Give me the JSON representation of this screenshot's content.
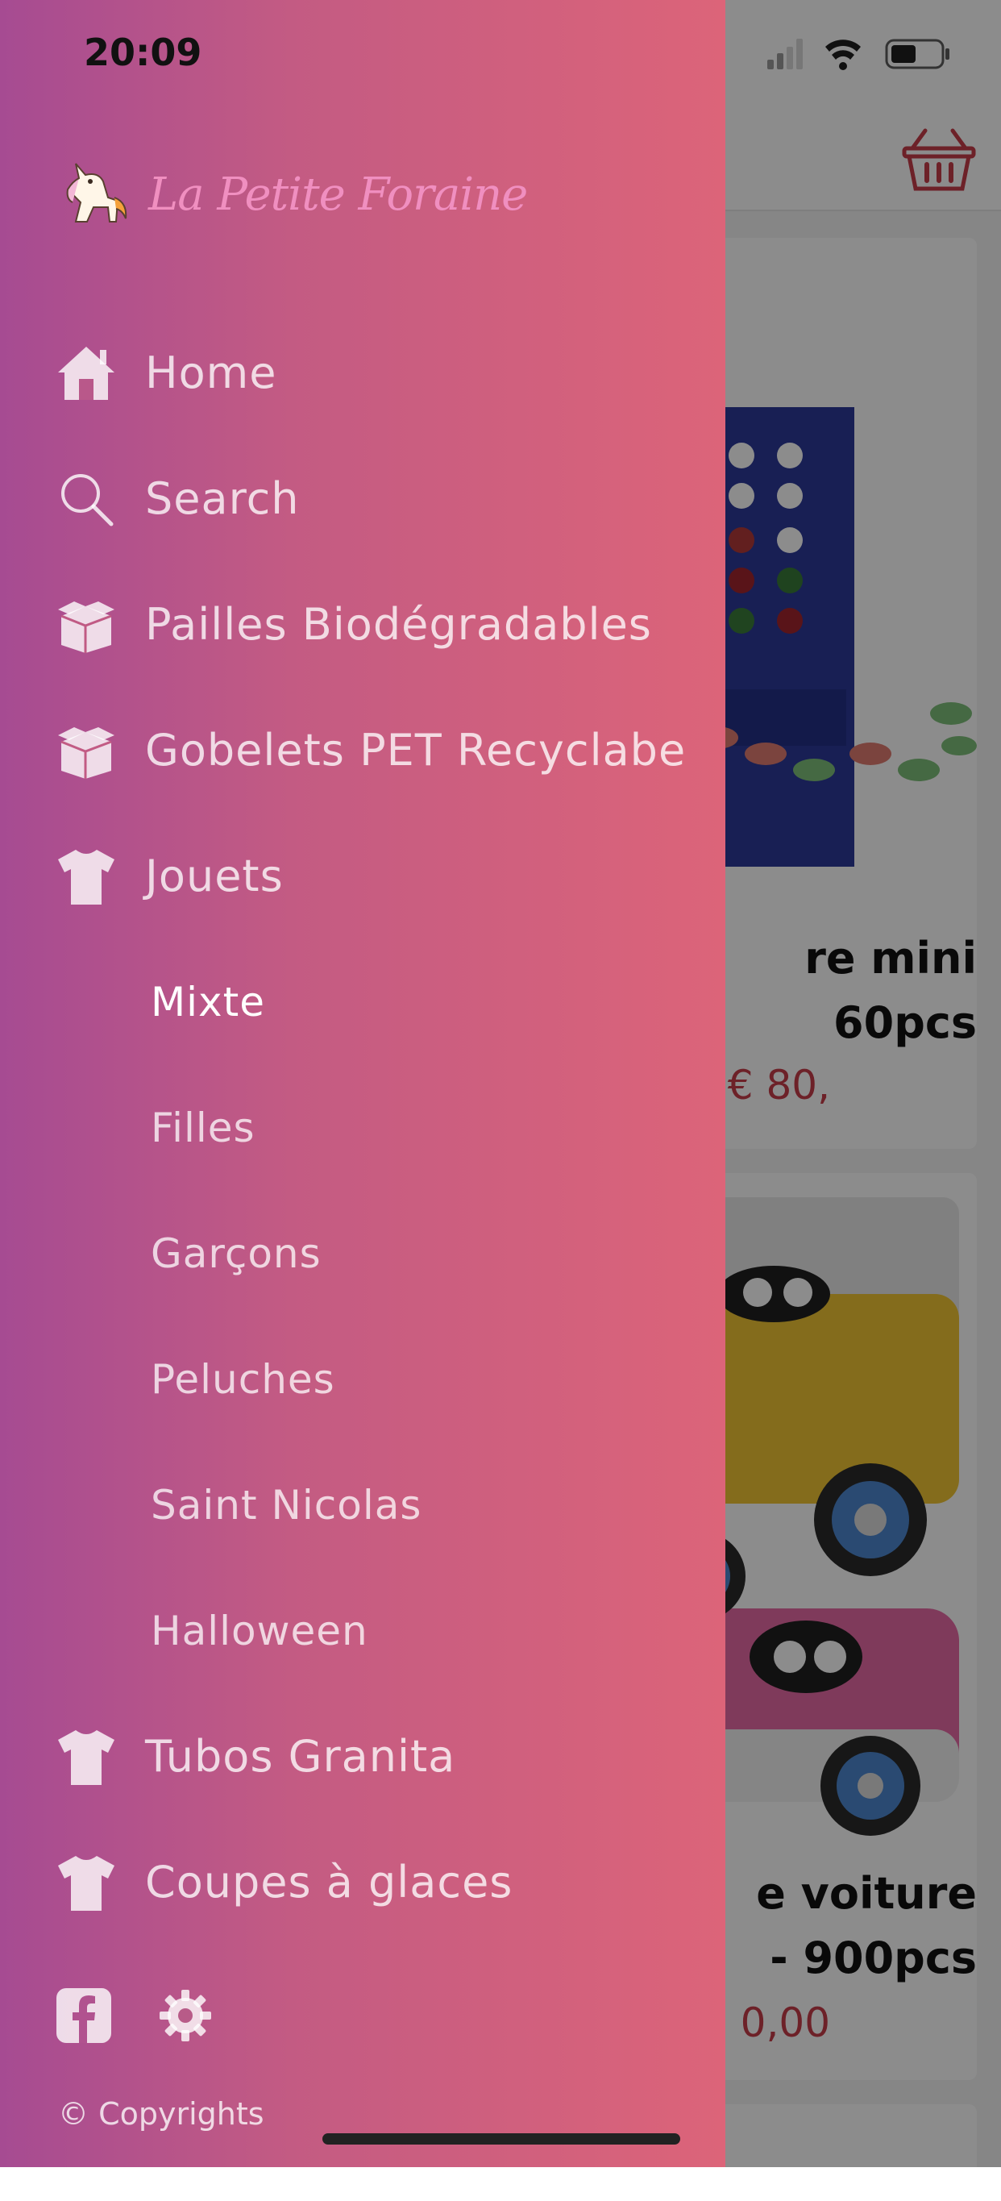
{
  "status_bar": {
    "time": "20:09"
  },
  "brand": {
    "name": "La Petite Foraine",
    "logo_icon": "unicorn-logo"
  },
  "menu": [
    {
      "label": "Home",
      "icon": "home-icon"
    },
    {
      "label": "Search",
      "icon": "search-icon"
    },
    {
      "label": "Pailles Biodégradables",
      "icon": "box-icon"
    },
    {
      "label": "Gobelets PET Recyclabe",
      "icon": "box-icon"
    },
    {
      "label": "Jouets",
      "icon": "tshirt-icon"
    }
  ],
  "submenu": [
    {
      "label": "Mixte",
      "active": true
    },
    {
      "label": "Filles",
      "active": false
    },
    {
      "label": "Garçons",
      "active": false
    },
    {
      "label": "Peluches",
      "active": false
    },
    {
      "label": "Saint Nicolas",
      "active": false
    },
    {
      "label": "Halloween",
      "active": false
    }
  ],
  "menu_bottom": [
    {
      "label": "Tubos Granita",
      "icon": "tshirt-icon"
    },
    {
      "label": "Coupes à glaces",
      "icon": "tshirt-icon"
    }
  ],
  "footer": {
    "copyright": "© Copyrights",
    "icons": [
      "facebook-icon",
      "settings-icon"
    ]
  },
  "background_products": [
    {
      "title_line1": "re mini",
      "title_line2": "60pcs",
      "price": ",80 €"
    },
    {
      "title_line1": "e voiture",
      "title_line2": "- 900pcs",
      "price": "0,00 €"
    }
  ],
  "colors": {
    "drawer_gradient_start": "#a64b92",
    "drawer_gradient_end": "#dc6479",
    "price": "#c63c4a",
    "logo_text": "#f08fc0"
  }
}
